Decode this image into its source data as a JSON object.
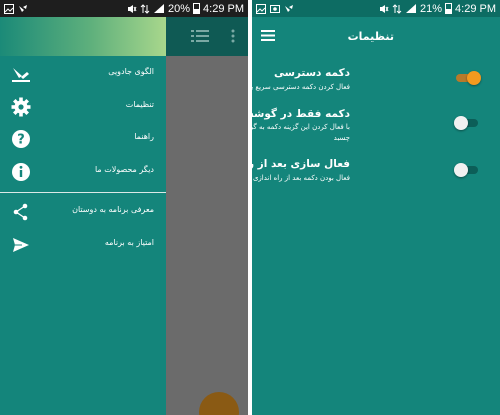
{
  "left": {
    "status": {
      "battery_pct": "20%",
      "time": "4:29 PM"
    },
    "drawer": {
      "items": [
        {
          "label": "الگوی جادویی",
          "icon": "magic-pattern-icon"
        },
        {
          "label": "تنظیمات",
          "icon": "gear-icon"
        },
        {
          "label": "راهنما",
          "icon": "help-icon"
        },
        {
          "label": "دیگر محصولات ما",
          "icon": "info-icon"
        }
      ],
      "secondary_items": [
        {
          "label": "معرفی برنامه به دوستان",
          "icon": "share-icon"
        },
        {
          "label": "امتیاز به برنامه",
          "icon": "send-icon"
        }
      ]
    }
  },
  "right": {
    "status": {
      "battery_pct": "21%",
      "time": "4:29 PM"
    },
    "toolbar": {
      "title": "تنظیمات",
      "menu_icon": "hamburger-icon"
    },
    "settings": [
      {
        "title": "دکمه دسترسی",
        "desc": "فعال کردن دکمه دسترسی سریع به جایگاه الگو",
        "enabled": true
      },
      {
        "title": "دکمه فقط در گوشه ها",
        "desc": "با فعال کردن این گزینه دکمه به گوشه های صفحه می چسبد",
        "enabled": false
      },
      {
        "title": "فعال سازی بعد از راه اندازی مجدد",
        "desc": "فعال بودن دکمه بعد از راه اندازی مجدد گوشی (ریبوت)",
        "enabled": false
      }
    ]
  },
  "colors": {
    "teal": "#14857b",
    "dark_teal": "#0d6c63",
    "accent_orange": "#f39a1e",
    "scrim_gray": "#6b6b6b"
  }
}
